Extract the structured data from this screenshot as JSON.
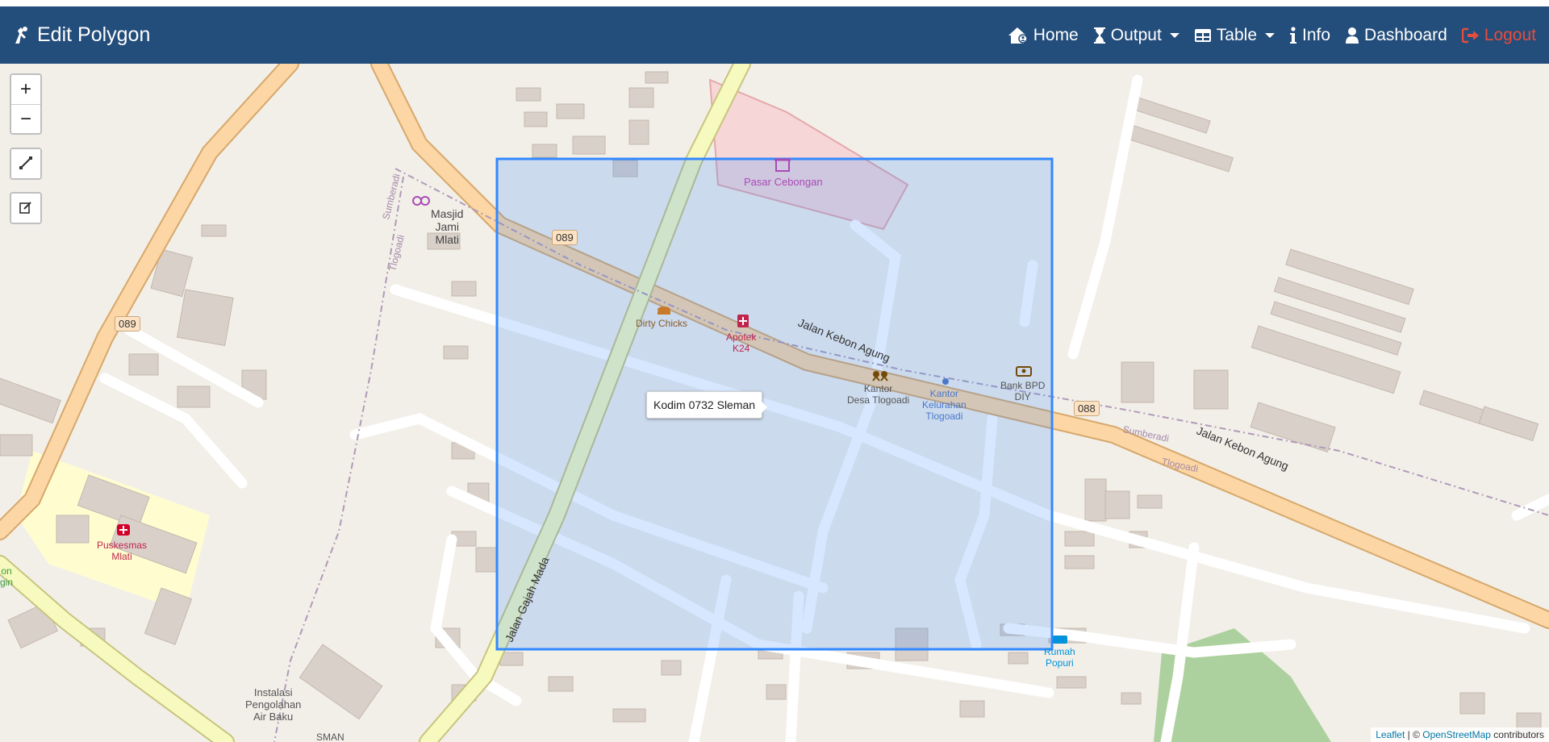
{
  "header": {
    "brand": "Edit Polygon",
    "nav": {
      "home": "Home",
      "output": "Output",
      "table": "Table",
      "info": "Info",
      "dashboard": "Dashboard",
      "logout": "Logout"
    },
    "colors": {
      "bar": "#234d7b",
      "logout": "#e74c3c"
    }
  },
  "map": {
    "controls": {
      "zoom_in": "+",
      "zoom_out": "−"
    },
    "tooltip": "Kodim 0732 Sleman",
    "labels": {
      "pasar": "Pasar Cebongan",
      "masjid": [
        "Masjid",
        "Jami",
        "Mlati"
      ],
      "dirty_chicks": "Dirty Chicks",
      "apotek": [
        "Apotek",
        "K24"
      ],
      "kantor_desa": [
        "Kantor",
        "Desa Tlogoadi"
      ],
      "kantor_kel": [
        "Kantor",
        "Kelurahan",
        "Tlogoadi"
      ],
      "bank": [
        "Bank BPD",
        "DIY"
      ],
      "puskesmas": [
        "Puskesmas",
        "Mlati"
      ],
      "instalasi": [
        "Instalasi",
        "Pengolahan",
        "Air Baku"
      ],
      "rumah": [
        "Rumah",
        "Popuri"
      ],
      "on": "on",
      "gin": "gin",
      "sleman_partial": "SMAN"
    },
    "roads": {
      "kebon_agung_1": "Jalan Kebon Agung",
      "kebon_agung_2": "Jalan Kebon Agung",
      "gajah_mada": "Jalan Gajah Mada",
      "sumberadi_1": "Sumberadi",
      "tlogoadi_1": "Tlogoadi",
      "sumberadi_2": "Sumberadi",
      "tlogoadi_2": "Tlogoadi"
    },
    "shields": {
      "s089a": "089",
      "s089b": "089",
      "s088": "088"
    },
    "attribution": {
      "leaflet": "Leaflet",
      "sep": " | © ",
      "osm": "OpenStreetMap",
      "suffix": " contributors"
    },
    "colors": {
      "background": "#f2efe9",
      "polygon_stroke": "#3388ff",
      "polygon_fill": "#3388ff",
      "primary_road": "#fcd6a4",
      "secondary_road": "#f7fabf",
      "building": "#d9d0c9"
    }
  }
}
